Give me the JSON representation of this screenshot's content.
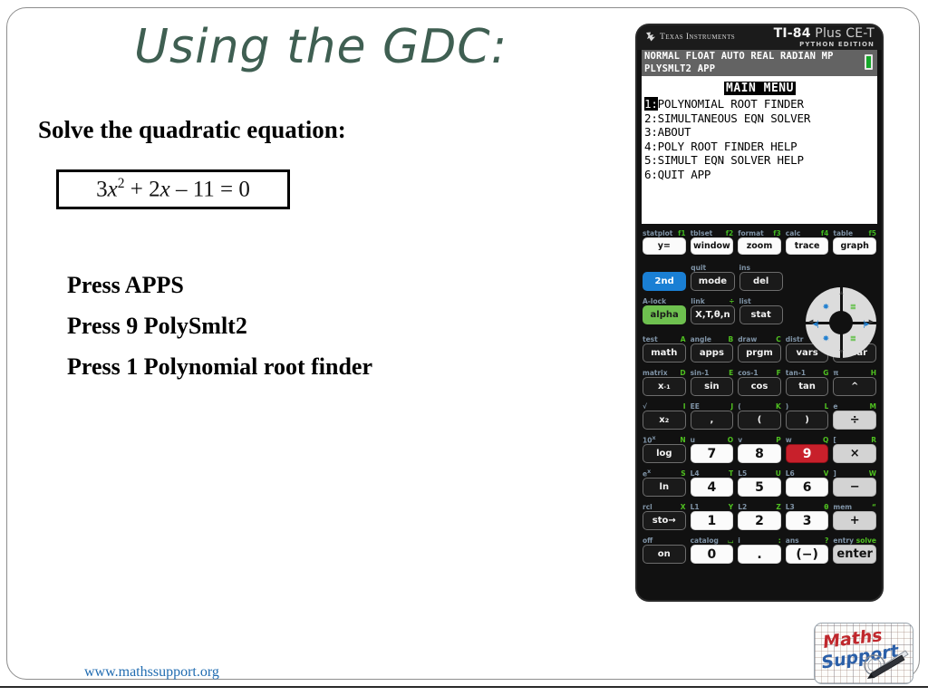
{
  "slide": {
    "title": "Using the GDC:",
    "prompt": "Solve the quadratic equation:",
    "equation_plain": "3x2 + 2x – 11 = 0",
    "equation": {
      "coef_a": "3",
      "var_a": "x",
      "exp_a": "2",
      "plus": " + ",
      "coef_b": "2",
      "var_b": "x",
      "minus": " – ",
      "constant": "11",
      "equals": " = ",
      "rhs": "0"
    },
    "steps": [
      "Press APPS",
      "Press 9 PolySmlt2",
      "Press 1 Polynomial root finder"
    ],
    "footer_url": "www.mathssupport.org",
    "title_color": "#3f5f52",
    "footer_color": "#1f6bb0"
  },
  "logo": {
    "line1": "Maths",
    "line2": "Support",
    "line1_color": "#c0282d",
    "line2_color": "#2b5fa8"
  },
  "calculator": {
    "brand": "Texas Instruments",
    "model_main": "TI-84",
    "model_main_light": " Plus CE-T",
    "model_sub": "PYTHON EDITION",
    "screen": {
      "status_line1": "NORMAL FLOAT AUTO REAL RADIAN MP",
      "status_line2": "PLYSMLT2 APP",
      "battery": "battery-full",
      "title": "MAIN MENU",
      "menu": [
        {
          "num": "1",
          "sep": ":",
          "label": "POLYNOMIAL ROOT FINDER",
          "selected": true
        },
        {
          "num": "2",
          "sep": ":",
          "label": "SIMULTANEOUS EQN SOLVER",
          "selected": false
        },
        {
          "num": "3",
          "sep": ":",
          "label": "ABOUT",
          "selected": false
        },
        {
          "num": "4",
          "sep": ":",
          "label": "POLY ROOT FINDER HELP",
          "selected": false
        },
        {
          "num": "5",
          "sep": ":",
          "label": "SIMULT EQN SOLVER HELP",
          "selected": false
        },
        {
          "num": "6",
          "sep": ":",
          "label": "QUIT APP",
          "selected": false
        }
      ]
    },
    "rows": {
      "fkeys_labels": [
        {
          "second": "statplot",
          "alpha": "f1"
        },
        {
          "second": "tblset",
          "alpha": "f2"
        },
        {
          "second": "format",
          "alpha": "f3"
        },
        {
          "second": "calc",
          "alpha": "f4"
        },
        {
          "second": "table",
          "alpha": "f5"
        }
      ],
      "fkeys": [
        "y=",
        "window",
        "zoom",
        "trace",
        "graph"
      ],
      "mode_labels": [
        {
          "second": "",
          "alpha": ""
        },
        {
          "second": "quit",
          "alpha": ""
        },
        {
          "second": "ins",
          "alpha": ""
        }
      ],
      "mode_keys": [
        "2nd",
        "mode",
        "del"
      ],
      "alpha_labels": [
        {
          "second": "A-lock",
          "alpha": ""
        },
        {
          "second": "link",
          "alpha": "÷"
        },
        {
          "second": "list",
          "alpha": ""
        }
      ],
      "alpha_keys": [
        "alpha",
        "X,T,θ,n",
        "stat"
      ],
      "math_labels": [
        {
          "second": "test",
          "alpha": "A"
        },
        {
          "second": "angle",
          "alpha": "B"
        },
        {
          "second": "draw",
          "alpha": "C"
        },
        {
          "second": "distr",
          "alpha": ""
        },
        {
          "second": "",
          "alpha": ""
        }
      ],
      "math_keys": [
        "math",
        "apps",
        "prgm",
        "vars",
        "clear"
      ],
      "trig_labels": [
        {
          "second": "matrix",
          "alpha": "D"
        },
        {
          "second": "sin-1",
          "alpha": "E"
        },
        {
          "second": "cos-1",
          "alpha": "F"
        },
        {
          "second": "tan-1",
          "alpha": "G"
        },
        {
          "second": "π",
          "alpha": "H"
        }
      ],
      "trig_keys": [
        "x-1",
        "sin",
        "cos",
        "tan",
        "^"
      ],
      "paren_labels": [
        {
          "second": "√",
          "alpha": "I"
        },
        {
          "second": "EE",
          "alpha": "J"
        },
        {
          "second": "(",
          "alpha": "K"
        },
        {
          "second": ")",
          "alpha": "L"
        },
        {
          "second": "e",
          "alpha": "M"
        }
      ],
      "paren_keys": [
        "x2",
        ",",
        "(",
        ")",
        "÷"
      ],
      "num789_labels": [
        {
          "second": "10x",
          "alpha": "N"
        },
        {
          "second": "u",
          "alpha": "O"
        },
        {
          "second": "v",
          "alpha": "P"
        },
        {
          "second": "w",
          "alpha": "Q"
        },
        {
          "second": "[",
          "alpha": "R"
        }
      ],
      "num789_keys": [
        "log",
        "7",
        "8",
        "9",
        "×"
      ],
      "num456_labels": [
        {
          "second": "ex",
          "alpha": "S"
        },
        {
          "second": "L4",
          "alpha": "T"
        },
        {
          "second": "L5",
          "alpha": "U"
        },
        {
          "second": "L6",
          "alpha": "V"
        },
        {
          "second": "]",
          "alpha": "W"
        }
      ],
      "num456_keys": [
        "ln",
        "4",
        "5",
        "6",
        "−"
      ],
      "num123_labels": [
        {
          "second": "rcl",
          "alpha": "X"
        },
        {
          "second": "L1",
          "alpha": "Y"
        },
        {
          "second": "L2",
          "alpha": "Z"
        },
        {
          "second": "L3",
          "alpha": "θ"
        },
        {
          "second": "mem",
          "alpha": "“"
        }
      ],
      "num123_keys": [
        "sto→",
        "1",
        "2",
        "3",
        "+"
      ],
      "num0_labels": [
        {
          "second": "off",
          "alpha": ""
        },
        {
          "second": "catalog",
          "alpha": "⌴"
        },
        {
          "second": "i",
          "alpha": ":"
        },
        {
          "second": "ans",
          "alpha": "?"
        },
        {
          "second": "entry",
          "alpha": "solve"
        }
      ],
      "num0_keys": [
        "on",
        "0",
        ".",
        "(−)",
        "enter"
      ]
    },
    "highlight_key": "9",
    "highlight_color": "#c8202b"
  }
}
